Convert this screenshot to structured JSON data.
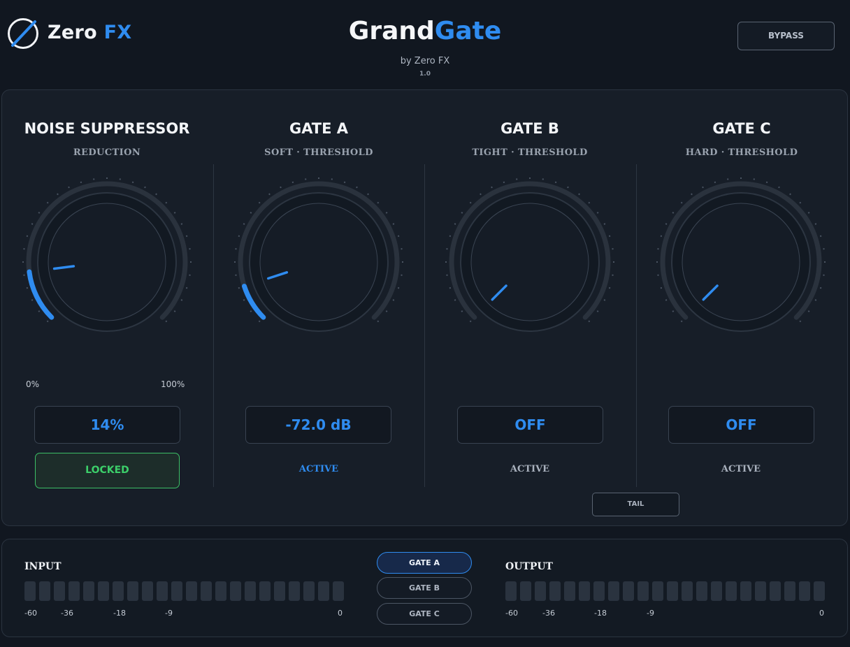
{
  "brand": {
    "name": "Zero",
    "name_accent": "FX"
  },
  "header": {
    "title_main": "Grand",
    "title_accent": "Gate",
    "subtitle": "by Zero FX",
    "version": "1.0",
    "bypass_label": "BYPASS"
  },
  "sections": {
    "noise": {
      "title": "NOISE SUPPRESSOR",
      "subtitle": "REDUCTION",
      "range_min": "0%",
      "range_max": "100%",
      "value": "14%",
      "knob_fraction": 0.14,
      "lock_label": "LOCKED"
    },
    "gate_a": {
      "title": "GATE A",
      "subtitle": "SOFT · THRESHOLD",
      "value": "-72.0 dB",
      "knob_fraction": 0.1,
      "status": "ACTIVE",
      "status_active": true
    },
    "gate_b": {
      "title": "GATE B",
      "subtitle": "TIGHT · THRESHOLD",
      "value": "OFF",
      "knob_fraction": 0,
      "status": "ACTIVE",
      "status_active": false
    },
    "gate_c": {
      "title": "GATE C",
      "subtitle": "HARD · THRESHOLD",
      "value": "OFF",
      "knob_fraction": 0,
      "status": "ACTIVE",
      "status_active": false,
      "tail_label": "TAIL"
    }
  },
  "meters": {
    "input": {
      "title": "INPUT",
      "ticks": [
        "-60",
        "-36",
        "-18",
        "-9",
        "0"
      ],
      "segments": 22,
      "level": 0
    },
    "output": {
      "title": "OUTPUT",
      "ticks": [
        "-60",
        "-36",
        "-18",
        "-9",
        "0"
      ],
      "segments": 22,
      "level": 0
    },
    "gate_buttons": [
      {
        "label": "GATE A",
        "active": true
      },
      {
        "label": "GATE B",
        "active": false
      },
      {
        "label": "GATE C",
        "active": false
      }
    ]
  },
  "colors": {
    "accent": "#2f8cf0",
    "locked_green": "#3ccf6a",
    "background": "#111720",
    "panel": "#171e28"
  }
}
